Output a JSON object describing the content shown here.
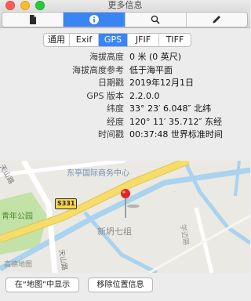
{
  "window": {
    "title": "更多信息"
  },
  "toolbar": {
    "segments": [
      {
        "icon": "document-icon"
      },
      {
        "icon": "info-icon",
        "selected": true
      },
      {
        "icon": "search-icon"
      },
      {
        "icon": "pencil-icon"
      }
    ]
  },
  "tabs": [
    "通用",
    "Exif",
    "GPS",
    "JFIF",
    "TIFF"
  ],
  "selected_tab": "GPS",
  "gps_info": [
    {
      "label": "海拔高度",
      "value": "0 米 (0 英尺)"
    },
    {
      "label": "海拔高度参考",
      "value": "低于海平面"
    },
    {
      "label": "日期戳",
      "value": "2019年12月1日"
    },
    {
      "label": "GPS 版本",
      "value": "2.2.0.0"
    },
    {
      "label": "纬度",
      "value": "33° 23′ 6.048″ 北纬"
    },
    {
      "label": "经度",
      "value": "120° 11′ 35.712″ 东经"
    },
    {
      "label": "时间戳",
      "value": "00:37:48 世界标准时间"
    }
  ],
  "map": {
    "labels": {
      "poi": "东亭国际商务中心",
      "road_badge": "S331",
      "park": "青年公园",
      "road_tianshan_top": "天山路",
      "road_tianshan_bottom": "天山路",
      "place": "新坍七组",
      "road_right": "学迈路"
    },
    "legal": "高德地图",
    "pin_color": "#e02525"
  },
  "buttons": {
    "show_in_maps": "在“地图”中显示",
    "remove_location": "移除位置信息"
  },
  "colors": {
    "accent": "#3a85f5",
    "road_yellow": "#f6dc6a",
    "water": "#a9d3ee",
    "park_green": "#c3e2a8"
  }
}
